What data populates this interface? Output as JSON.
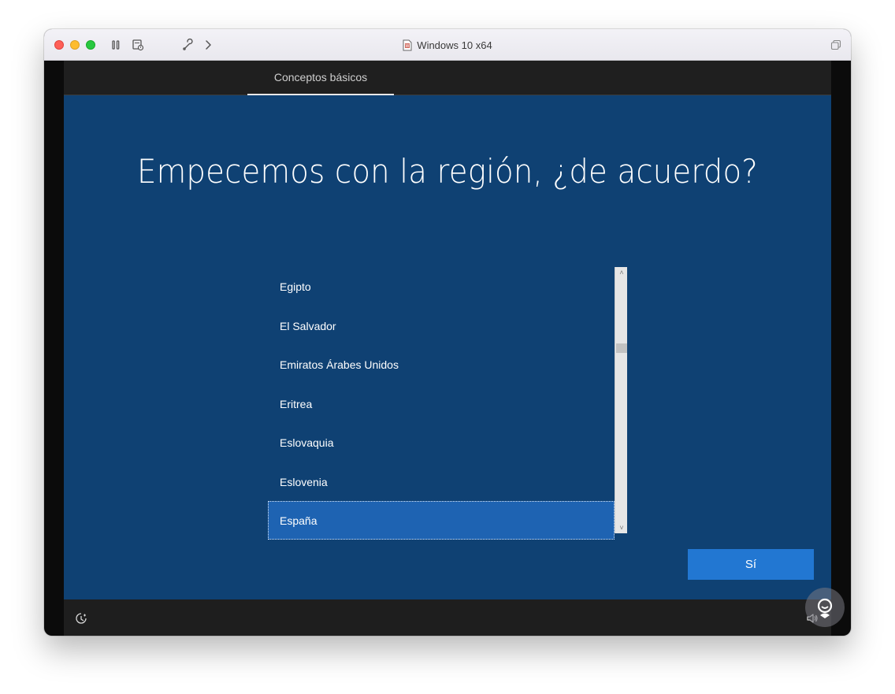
{
  "window": {
    "title": "Windows 10 x64",
    "icons": [
      "pause-icon",
      "snapshot-icon",
      "settings-wrench-icon",
      "chevron-right-icon",
      "restore-window-icon"
    ]
  },
  "oobe": {
    "tab_label": "Conceptos básicos",
    "heading": "Empecemos con la región, ¿de acuerdo?",
    "regions": [
      "Egipto",
      "El Salvador",
      "Emiratos Árabes Unidos",
      "Eritrea",
      "Eslovaquia",
      "Eslovenia",
      "España"
    ],
    "selected_region": "España",
    "scroll_position_fraction": 0.28,
    "confirm_label": "Sí",
    "footer_icons": [
      "ease-of-access-icon",
      "volume-icon"
    ]
  },
  "colors": {
    "background": "#0f4173",
    "selected_item": "#1e63b2",
    "button": "#2277d2",
    "header": "#1f1f1f"
  }
}
